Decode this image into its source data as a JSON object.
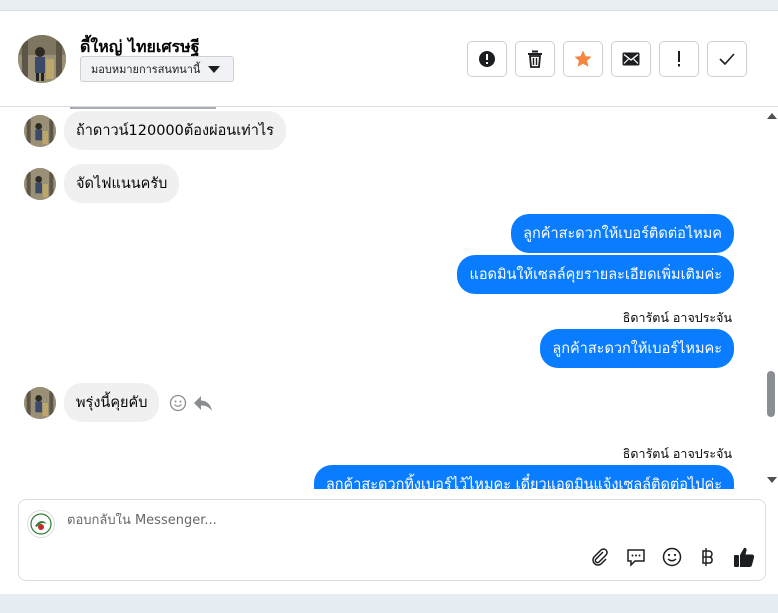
{
  "header": {
    "contact_name": "ดี้ใหญ่ ไทยเศรษฐี",
    "assign_label": "มอบหมายการสนทนานี้",
    "tools": [
      {
        "name": "spam-button",
        "icon": "alert-circle-icon"
      },
      {
        "name": "delete-button",
        "icon": "trash-icon"
      },
      {
        "name": "star-button",
        "icon": "star-icon"
      },
      {
        "name": "mark-unread-button",
        "icon": "envelope-icon"
      },
      {
        "name": "flag-button",
        "icon": "exclamation-icon"
      },
      {
        "name": "done-button",
        "icon": "check-icon"
      }
    ]
  },
  "messages": [
    {
      "dir": "in",
      "text": "ถ้าดาวน์120000ต้องผ่อนเท่าไร"
    },
    {
      "dir": "in",
      "text": "จัดไฟแนนครับ"
    },
    {
      "dir": "out",
      "text": "ลูกค้าสะดวกให้เบอร์ติดต่อไหมค"
    },
    {
      "dir": "out",
      "text": "แอดมินให้เซลล์คุยรายละเอียดเพิ่มเติมค่ะ"
    },
    {
      "dir": "sender",
      "text": "ธิดารัตน์ อาจประจัน"
    },
    {
      "dir": "out",
      "text": "ลูกค้าสะดวกให้เบอร์ไหมคะ"
    },
    {
      "dir": "in",
      "text": "พรุ่งนี้คุยคับ"
    },
    {
      "dir": "sender",
      "text": "ธิดารัตน์ อาจประจัน"
    },
    {
      "dir": "out",
      "text": "ลูกค้าสะดวกทิ้งเบอร์ไว้ไหมคะ เดี๋ยวแอดมินแจ้งเซลล์ติดต่อไปค่ะ"
    }
  ],
  "composer": {
    "placeholder": "ตอบกลับใน Messenger...",
    "tools": [
      "paperclip-icon",
      "saved-reply-icon",
      "emoji-icon",
      "baht-icon",
      "thumbs-up-icon"
    ]
  },
  "colors": {
    "outgoing_bubble": "#0a7cff",
    "incoming_bubble": "#f0f0f0",
    "star": "#f5853f"
  }
}
